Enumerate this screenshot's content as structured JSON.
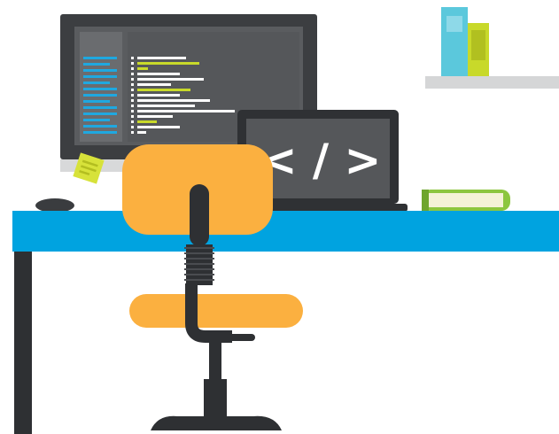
{
  "laptop_screen": {
    "code_symbol": "< / >"
  },
  "colors": {
    "desk_top": "#00A3E0",
    "desk_leg": "#2E3033",
    "chair_seat": "#FBB040",
    "chair_frame": "#2E3033",
    "monitor_bezel": "#3C3E41",
    "monitor_stand": "#D8D9DA",
    "screen_dark": "#4F5154",
    "screen_panel": "#6A6C6F",
    "code_highlight_blue": "#1FA8E0",
    "code_highlight_green": "#C8D92A",
    "code_text": "#FFFFFF",
    "laptop_body": "#2F3134",
    "laptop_screen": "#55575A",
    "sticky_note": "#D7E23A",
    "book_cover": "#8DC63F",
    "book_pages": "#F5F2D7",
    "shelf": "#D5D6D7",
    "shelf_book_blue": "#5BC8DC",
    "shelf_book_green": "#C8D92A",
    "mouse": "#3A3C3F"
  },
  "icons": {
    "monitor": "monitor-icon",
    "laptop": "laptop-icon",
    "chair": "office-chair-icon",
    "mouse": "mouse-icon",
    "sticky_note": "sticky-note-icon",
    "book": "book-icon",
    "shelf": "shelf-icon"
  }
}
